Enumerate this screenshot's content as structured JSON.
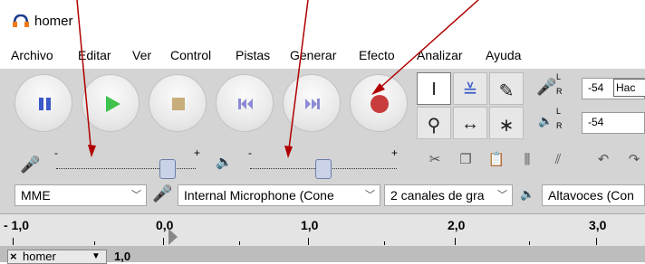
{
  "window": {
    "title": "homer"
  },
  "menu": [
    "Archivo",
    "Editar",
    "Ver",
    "Control",
    "Pistas",
    "Generar",
    "Efecto",
    "Analizar",
    "Ayuda"
  ],
  "transport": [
    {
      "name": "pause-button",
      "icon": "pause-icon"
    },
    {
      "name": "play-button",
      "icon": "play-icon"
    },
    {
      "name": "stop-button",
      "icon": "stop-icon"
    },
    {
      "name": "skip-start-button",
      "icon": "skip-start-icon"
    },
    {
      "name": "skip-end-button",
      "icon": "skip-end-icon"
    },
    {
      "name": "record-button",
      "icon": "record-icon"
    }
  ],
  "meters": {
    "record_value": "-54",
    "record_box": "Hac",
    "play_value": "-54",
    "channel_l": "L",
    "channel_r": "R"
  },
  "mixer": {
    "minus": "-",
    "plus": "+",
    "record_level": 0.8,
    "play_level": 0.5
  },
  "devices": {
    "host": "MME",
    "mic": "Internal Microphone (Cone",
    "channels": "2 canales de gra",
    "output": "Altavoces (Con"
  },
  "ruler": {
    "labels": [
      "- 1,0",
      "0,0",
      "1,0",
      "2,0",
      "3,0"
    ]
  },
  "track": {
    "name": "homer",
    "value": "1,0"
  },
  "colors": {
    "pause": "#3b59c9",
    "play": "#3ec24b",
    "stop": "#c9ad7a",
    "skip": "#8b8bd4",
    "record": "#c93c3c",
    "annotation_arrow": "#b00000"
  }
}
